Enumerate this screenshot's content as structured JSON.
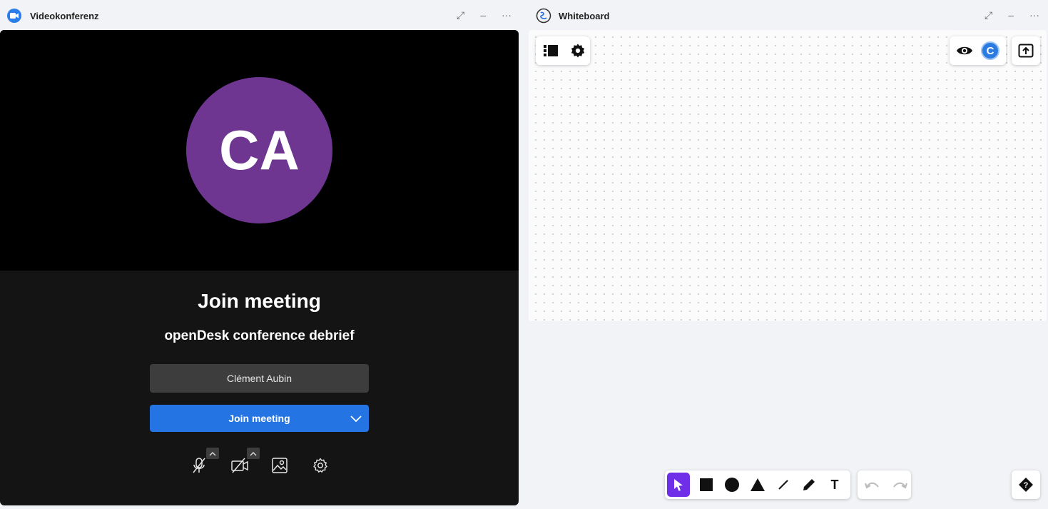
{
  "video_widget": {
    "title": "Videokonferenz",
    "controls": {
      "expand": "⤢",
      "minimize": "–",
      "more": "···"
    },
    "avatar_initials": "CA",
    "avatar_color": "#6e3591",
    "join_title": "Join meeting",
    "meeting_name": "openDesk conference debrief",
    "display_name": "Clément Aubin",
    "join_button_label": "Join meeting",
    "accent": "#2474e4",
    "toolbar_icons": [
      "microphone-muted-icon",
      "camera-off-icon",
      "virtual-background-icon",
      "settings-gear-icon"
    ]
  },
  "whiteboard_widget": {
    "title": "Whiteboard",
    "controls": {
      "expand": "⤢",
      "minimize": "–",
      "more": "···"
    },
    "top_left_tools": [
      "list-menu-icon",
      "settings-icon"
    ],
    "top_right_tools": [
      "eye-icon",
      "collaborator-avatar"
    ],
    "collaborator_initial": "C",
    "export_icon": "export-upload-icon",
    "draw_tools": [
      "select-pointer-icon",
      "rectangle-icon",
      "circle-icon",
      "triangle-icon",
      "line-icon",
      "pen-icon",
      "text-tool"
    ],
    "text_tool_label": "T",
    "active_tool_color": "#6f2ee8",
    "history_tools": [
      "undo-icon",
      "redo-icon"
    ],
    "help_icon": "help-icon"
  }
}
